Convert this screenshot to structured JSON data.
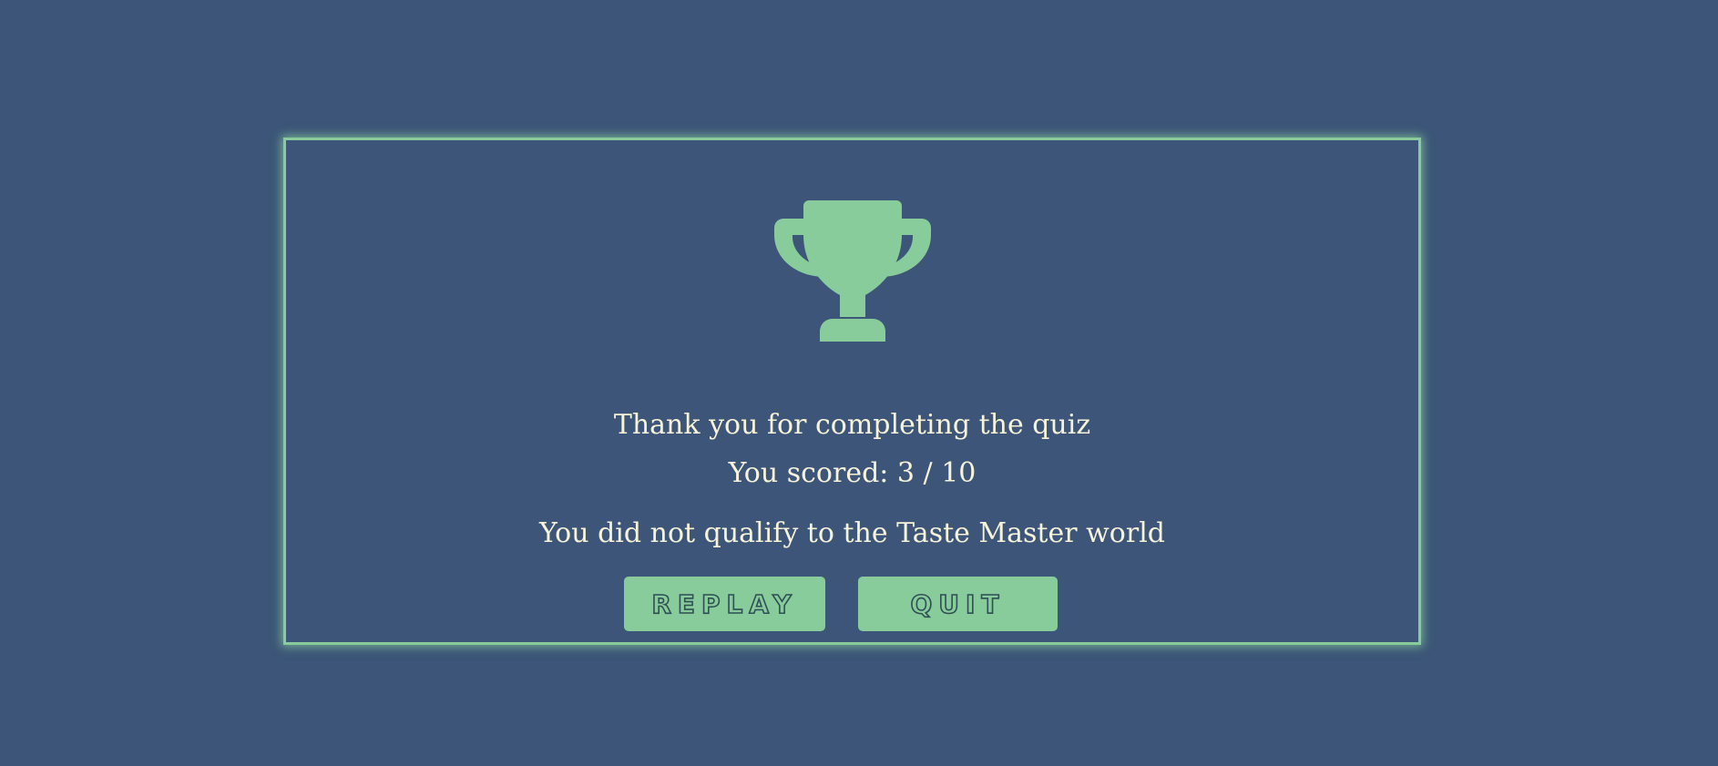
{
  "result": {
    "icon": "trophy-icon",
    "thanks_text": "Thank you for completing the quiz",
    "score_label": "You scored: 3 / 10",
    "qualification_text": "You did not qualify to the Taste Master world"
  },
  "actions": {
    "replay_label": "REPLAY",
    "quit_label": "QUIT"
  },
  "colors": {
    "background": "#3c5578",
    "accent": "#87cc9a",
    "text": "#f7f3d8",
    "button_text_outline": "#2f4f55"
  }
}
